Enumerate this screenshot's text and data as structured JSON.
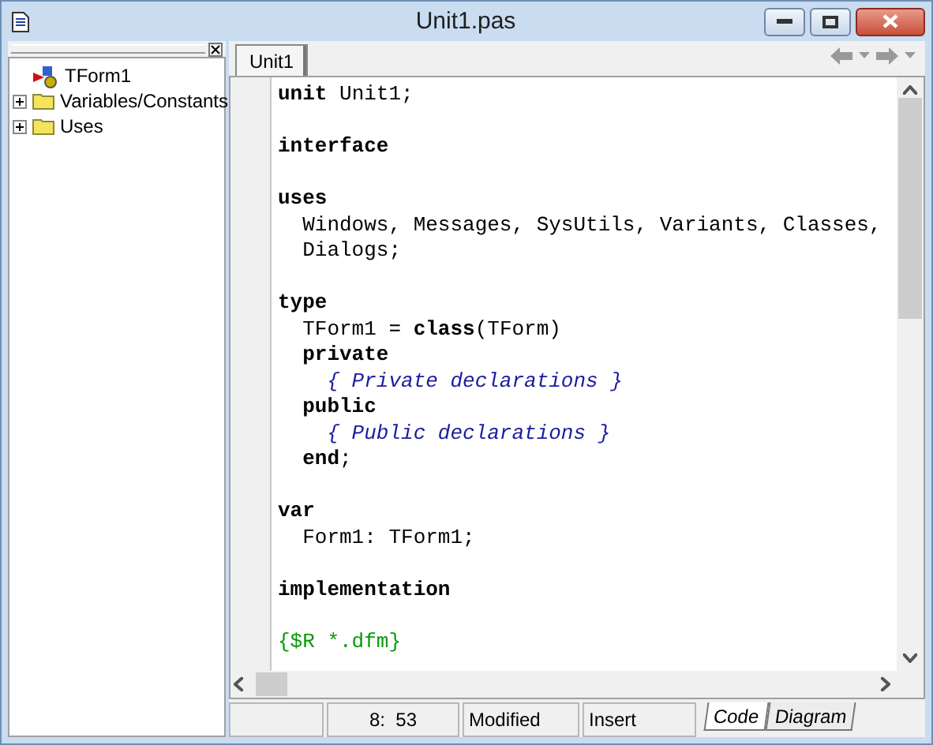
{
  "window": {
    "title": "Unit1.pas"
  },
  "explorer": {
    "items": [
      {
        "label": "TForm1",
        "kind": "form",
        "expandable": false
      },
      {
        "label": "Variables/Constants",
        "kind": "folder",
        "expandable": true
      },
      {
        "label": "Uses",
        "kind": "folder",
        "expandable": true
      }
    ]
  },
  "tabs": [
    {
      "label": "Unit1",
      "selected": true
    }
  ],
  "code": [
    {
      "tokens": [
        {
          "kind": "keyword",
          "text": "unit"
        },
        {
          "kind": "plain",
          "text": " Unit1;"
        }
      ]
    },
    {
      "blank_before": true,
      "tokens": [
        {
          "kind": "keyword",
          "text": "interface"
        }
      ]
    },
    {
      "blank_before": true,
      "tokens": [
        {
          "kind": "keyword",
          "text": "uses"
        }
      ]
    },
    {
      "tokens": [
        {
          "kind": "plain",
          "text": "  Windows, Messages, SysUtils, Variants, Classes,"
        }
      ]
    },
    {
      "tokens": [
        {
          "kind": "plain",
          "text": "  Dialogs;"
        }
      ]
    },
    {
      "blank_before": true,
      "tokens": [
        {
          "kind": "keyword",
          "text": "type"
        }
      ]
    },
    {
      "tokens": [
        {
          "kind": "plain",
          "text": "  TForm1 = "
        },
        {
          "kind": "keyword",
          "text": "class"
        },
        {
          "kind": "plain",
          "text": "(TForm)"
        }
      ]
    },
    {
      "tokens": [
        {
          "kind": "keyword",
          "text": "  private"
        }
      ]
    },
    {
      "tokens": [
        {
          "kind": "comment",
          "text": "    { Private declarations }"
        }
      ]
    },
    {
      "tokens": [
        {
          "kind": "keyword",
          "text": "  public"
        }
      ]
    },
    {
      "tokens": [
        {
          "kind": "comment",
          "text": "    { Public declarations }"
        }
      ]
    },
    {
      "tokens": [
        {
          "kind": "keyword",
          "text": "  end"
        },
        {
          "kind": "plain",
          "text": ";"
        }
      ]
    },
    {
      "blank_before": true,
      "tokens": [
        {
          "kind": "keyword",
          "text": "var"
        }
      ]
    },
    {
      "tokens": [
        {
          "kind": "plain",
          "text": "  Form1: TForm1;"
        }
      ]
    },
    {
      "blank_before": true,
      "tokens": [
        {
          "kind": "keyword",
          "text": "implementation"
        }
      ]
    },
    {
      "blank_before": true,
      "tokens": [
        {
          "kind": "directive",
          "text": "{$R *.dfm}"
        }
      ]
    }
  ],
  "status_bar": {
    "position": "8:  53",
    "state": "Modified",
    "mode": "Insert"
  },
  "view_tabs": [
    {
      "label": "Code",
      "selected": true
    },
    {
      "label": "Diagram",
      "selected": false
    }
  ]
}
